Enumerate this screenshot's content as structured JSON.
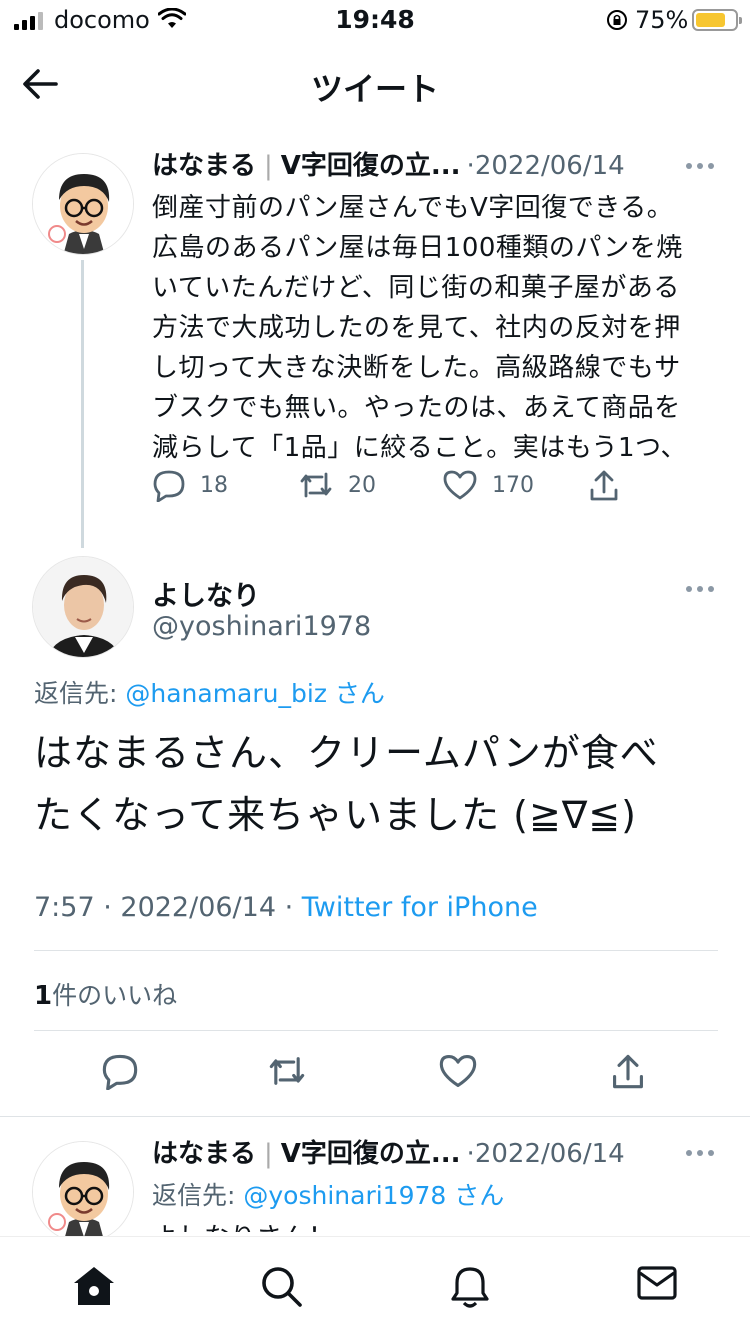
{
  "status_bar": {
    "carrier": "docomo",
    "time": "19:48",
    "battery_percent": "75%",
    "battery_level": 0.75,
    "battery_color": "#f7c630"
  },
  "header": {
    "title": "ツイート",
    "back_icon": "arrow-left-icon"
  },
  "tweet1": {
    "name": "はなまる",
    "separator": "|",
    "name_suffix": "V字回復の立...",
    "date": "2022/06/14",
    "body_lines": [
      "倒産寸前のパン屋さんでもV字回復できる。",
      "広島のあるパン屋は毎日100種類のパンを焼",
      "いていたんだけど、同じ街の和菓子屋がある",
      "方法で大成功したのを見て、社内の反対を押",
      "し切って大きな決断をした。高級路線でもサ",
      "ブスクでも無い。やったのは、あえて商品を",
      "減らして「1品」に絞ること。実はもう1つ、"
    ],
    "replies": "18",
    "retweets": "20",
    "likes": "170"
  },
  "main_tweet": {
    "name": "よしなり",
    "handle": "@yoshinari1978",
    "reply_label": "返信先: ",
    "reply_link": "@hanamaru_biz",
    "reply_suffix": " さん",
    "text_lines": [
      "はなまるさん、クリームパンが食べ",
      "たくなって来ちゃいました (≧∇≦)"
    ],
    "time": "7:57",
    "dot": " · ",
    "date": "2022/06/14",
    "source": "Twitter for iPhone",
    "like_count": "1",
    "like_label": "件のいいね"
  },
  "tweet3": {
    "name": "はなまる",
    "separator": "|",
    "name_suffix": "V字回復の立...",
    "date": "2022/06/14",
    "reply_label": "返信先: ",
    "reply_link": "@yoshinari1978",
    "reply_suffix": " さん",
    "cut_text": "よしなりさん！"
  },
  "tabbar": {
    "items": [
      "home-icon",
      "search-icon",
      "notifications-icon",
      "messages-icon"
    ]
  },
  "colors": {
    "accent": "#1d9bf0",
    "secondary_text": "#536471",
    "thread_line": "#cfd9de"
  }
}
